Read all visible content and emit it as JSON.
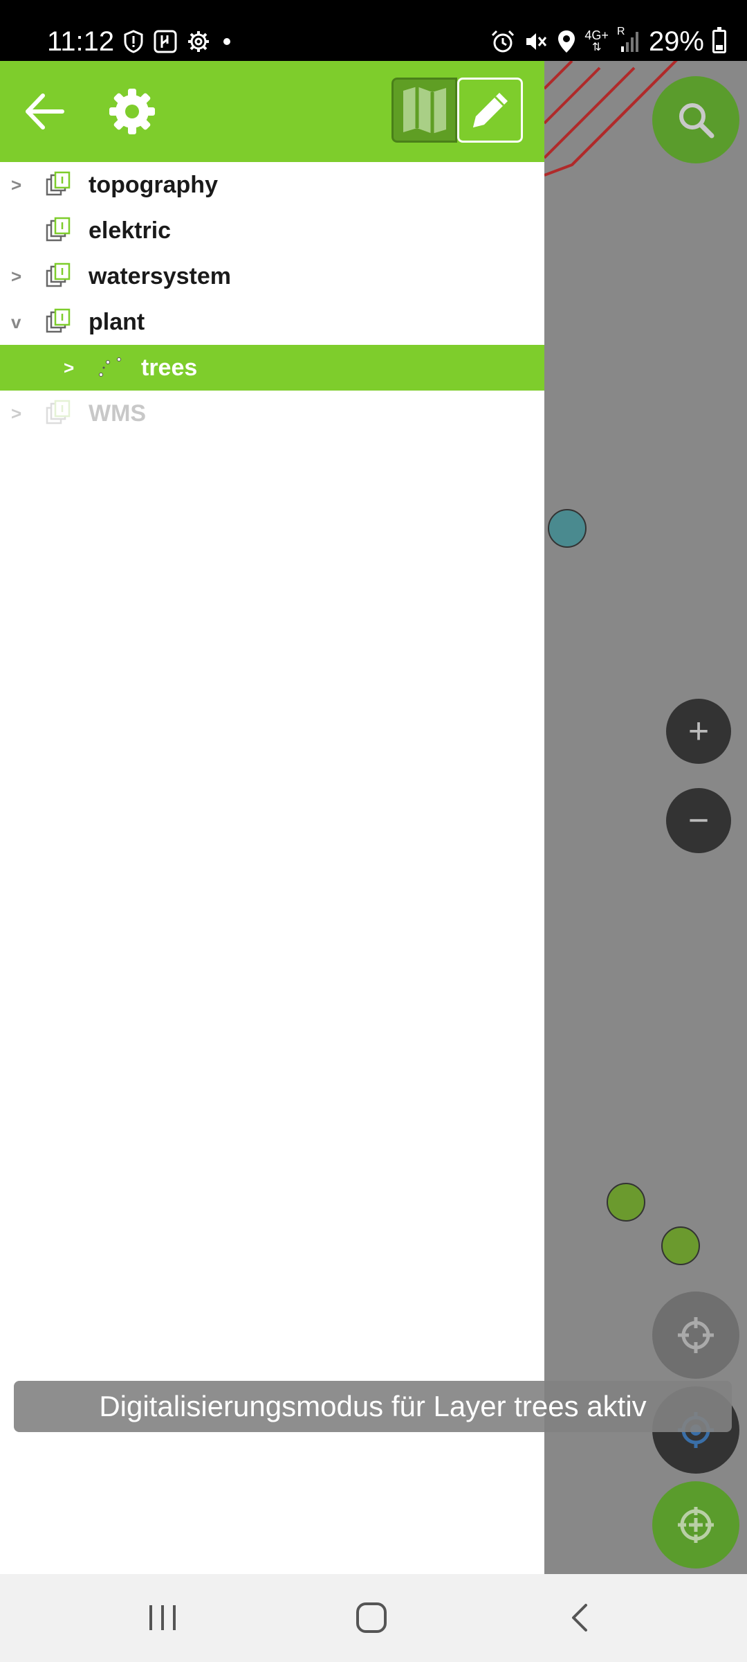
{
  "status_bar": {
    "time": "11:12",
    "battery": "29%",
    "network": "4G+",
    "roaming": "R",
    "left_icons": [
      "shield-icon",
      "usb-debug-icon",
      "settings-icon",
      "dot-icon"
    ],
    "right_icons": [
      "alarm-icon",
      "mute-icon",
      "location-icon",
      "network-icon",
      "signal-icon",
      "battery-icon"
    ]
  },
  "header": {
    "back_icon": "arrow-left-icon",
    "settings_icon": "gear-icon",
    "mode_toggle": {
      "map_icon": "map-icon",
      "edit_icon": "pencil-icon",
      "active": "edit"
    }
  },
  "layers": [
    {
      "label": "topography",
      "expander": ">",
      "level": 0,
      "state": "normal"
    },
    {
      "label": "elektric",
      "expander": "",
      "level": 0,
      "state": "normal"
    },
    {
      "label": "watersystem",
      "expander": ">",
      "level": 0,
      "state": "normal"
    },
    {
      "label": "plant",
      "expander": "v",
      "level": 0,
      "state": "normal"
    },
    {
      "label": "trees",
      "expander": ">",
      "level": 1,
      "state": "selected"
    },
    {
      "label": "WMS",
      "expander": ">",
      "level": 0,
      "state": "disabled"
    }
  ],
  "map_controls": {
    "search_icon": "search-icon",
    "zoom_in": "+",
    "zoom_out": "−",
    "locate_icon": "crosshair-icon",
    "center_icon": "gps-center-icon",
    "add_icon": "add-point-icon"
  },
  "toast": {
    "message": "Digitalisierungsmodus für Layer trees aktiv"
  },
  "colors": {
    "accent": "#7ecd2c",
    "accent_dark": "#5f9e24",
    "map_background": "#888888"
  }
}
